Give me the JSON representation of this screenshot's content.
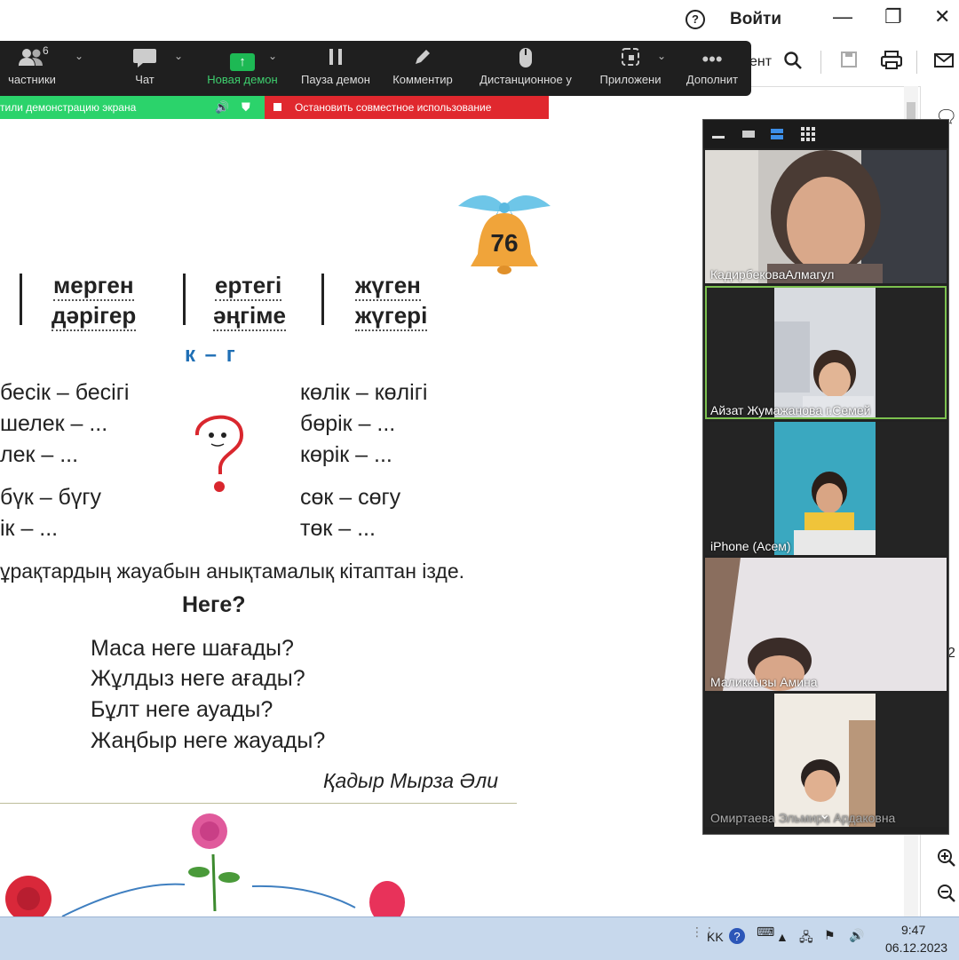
{
  "topbar": {
    "help_icon": "?",
    "login_label": "Войти",
    "minimize": "—",
    "maximize": "❐",
    "close": "✕"
  },
  "viewer": {
    "partial_label": "ент"
  },
  "zoom_toolbar": {
    "participants_count": "6",
    "items": [
      {
        "label": "частники",
        "icon": "participants-icon"
      },
      {
        "label": "Чат",
        "icon": "chat-icon"
      },
      {
        "label": "Новая демон",
        "icon": "share-screen-icon"
      },
      {
        "label": "Пауза демон",
        "icon": "pause-icon"
      },
      {
        "label": "Комментир",
        "icon": "pencil-icon"
      },
      {
        "label": "Дистанционное у",
        "icon": "mouse-icon"
      },
      {
        "label": "Приложени",
        "icon": "apps-icon"
      },
      {
        "label": "Дополнит",
        "icon": "more-icon"
      }
    ]
  },
  "share_banner": {
    "text": "тили демонстрацию экрана",
    "stop_label": "Остановить совместное использование"
  },
  "document": {
    "page_number": "76",
    "words_top": [
      "мерген",
      "ертегі",
      "жүген"
    ],
    "words_bottom": [
      "дәрігер",
      "әңгіме",
      "жүгері"
    ],
    "kg": "к – г",
    "left_col": [
      "бесік – бесігі",
      "шелек – ...",
      "лек – ..."
    ],
    "right_col": [
      "көлік – көлігі",
      "бөрік – ...",
      "көрік – ..."
    ],
    "left_col2": [
      "бүк – бүгу",
      "ік – ..."
    ],
    "right_col2": [
      "сөк – сөгу",
      "төк – ..."
    ],
    "instruction": "ұрақтардың жауабын анықтамалық кітаптан ізде.",
    "poem_title": "Неге?",
    "poem": [
      "Маса неге шағады?",
      "Жұлдыз неге ағады?",
      "Бұлт неге ауады?",
      "Жаңбыр неге жауады?"
    ],
    "author": "Қадыр Мырза Әли"
  },
  "video_panel": {
    "participants": [
      {
        "name": "КадирбековаАлмагул",
        "active": false
      },
      {
        "name": "Айзат Жумажанова г.Семей",
        "active": true
      },
      {
        "name": "iPhone (Асем)",
        "active": false
      },
      {
        "name": "Маликкызы Амина",
        "active": false
      },
      {
        "name": "Омиртаева Эльмира Ардаковна",
        "active": false
      }
    ]
  },
  "taskbar": {
    "lang": "KK",
    "time": "9:47",
    "date": "06.12.2023"
  },
  "right_strip": {
    "partial_2": "2"
  },
  "colors": {
    "toolbar_bg": "#1f1f1f",
    "share_green": "#2bd36b",
    "stop_red": "#e0282e",
    "kg_blue": "#1f6fb5",
    "active_tile": "#7cc14f"
  }
}
